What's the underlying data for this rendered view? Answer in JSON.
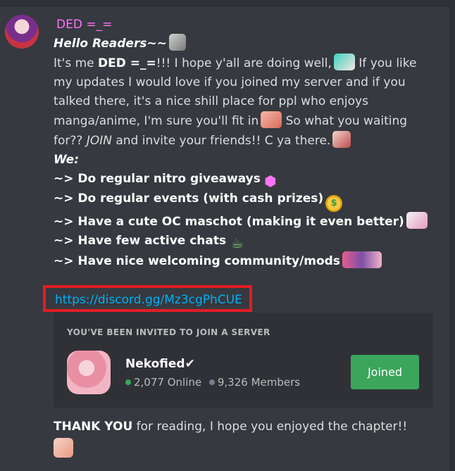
{
  "author": {
    "username": "DED =_="
  },
  "message": {
    "greeting": "Hello Readers~~",
    "p1": {
      "a": "It's me ",
      "b": "DED =_=",
      "c": "!!! I hope y'all are doing well,",
      "d": " If you like",
      "line2": "my updates I would love if you  joined my server and if you",
      "line3": "talked there, it's a nice shill place for ppl who enjoys",
      "line4a": "manga/anime, I'm sure you'll fit in",
      "line4b": " So what you waiting",
      "line5a": "for?? ",
      "line5b": "JOIN",
      "line5c": "  and invite your friends!! C ya there."
    },
    "we": "We:",
    "bullets": [
      "~> Do regular nitro giveaways",
      "~> Do regular events (with cash prizes)",
      "~> Have a cute OC maschot (making it even better)",
      "~> Have few active chats",
      "~> Have nice welcoming community/mods"
    ],
    "link": "https://discord.gg/Mz3cgPhCUE"
  },
  "invite": {
    "header": "YOU'VE BEEN INVITED TO JOIN A SERVER",
    "server_name": "Nekofied✔",
    "online": "2,077 Online",
    "members": "9,326 Members",
    "button": "Joined"
  },
  "footer": {
    "bold": "THANK YOU",
    "rest": "  for reading, I hope you enjoyed the chapter!!"
  },
  "colors": {
    "username": "#ff73fa",
    "link": "#00aff4",
    "joined": "#3ba55c",
    "highlight_border": "#e41c25"
  },
  "icons": [
    "cat-emoji-icon",
    "miku-emoji-icon",
    "pig-emoji-icon",
    "anime-girl-emoji-icon",
    "nitro-gem-icon",
    "money-face-icon",
    "oc-mascot-emoji-icon",
    "tea-emoji-icon",
    "mods-emoji-icon"
  ]
}
